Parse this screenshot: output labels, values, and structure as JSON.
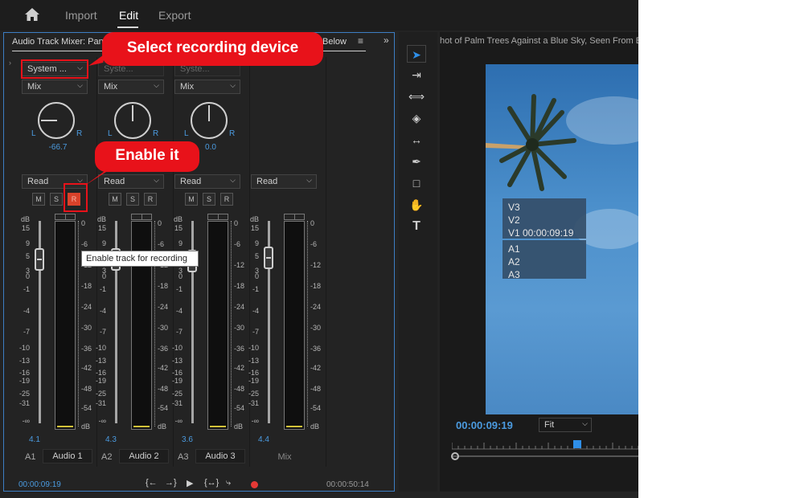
{
  "topbar": {
    "items": [
      "Import",
      "Edit",
      "Export"
    ],
    "active": "Edit"
  },
  "mixer": {
    "title": "Audio Track Mixer: Pan",
    "title_right": "Below",
    "menu_icon": "hamburger-icon",
    "left_scale": [
      "dB",
      "15",
      "9",
      "5",
      "3",
      "0",
      "-1",
      "-4",
      "-7",
      "-10",
      "-13",
      "-16",
      "-19",
      "-25",
      "-31",
      "-∞"
    ],
    "right_scale": [
      "0",
      "-6",
      "-12",
      "-18",
      "-24",
      "-30",
      "-36",
      "-42",
      "-48",
      "-54",
      "dB"
    ],
    "channels": [
      {
        "input": "System ...",
        "automation_top": "Mix",
        "pan": "-66.7",
        "automation": "Read",
        "level": "4.1",
        "id": "A1",
        "name": "Audio 1"
      },
      {
        "input": "Syste...",
        "automation_top": "Mix",
        "pan": "",
        "automation": "Read",
        "level": "4.3",
        "id": "A2",
        "name": "Audio 2"
      },
      {
        "input": "Syste...",
        "automation_top": "Mix",
        "pan": "0.0",
        "automation": "Read",
        "level": "3.6",
        "id": "A3",
        "name": "Audio 3"
      },
      {
        "input": "",
        "automation_top": "",
        "pan": "",
        "automation": "Read",
        "level": "4.4",
        "id": "",
        "name": "Mix"
      }
    ],
    "buttons": {
      "mute": "M",
      "solo": "S",
      "record": "R"
    },
    "knob_labels": {
      "left": "L",
      "right": "R"
    },
    "tooltip": "Enable track for recording",
    "timecode_current": "00:00:09:19",
    "timecode_end": "00:00:50:14",
    "transport": [
      "go-to-in-icon",
      "go-to-out-icon",
      "play-icon",
      "loop-icon",
      "export-icon",
      "record-icon"
    ]
  },
  "tools": [
    "selection-tool-icon",
    "track-select-icon",
    "ripple-edit-icon",
    "razor-icon",
    "slip-icon",
    "pen-icon",
    "rectangle-icon",
    "hand-icon",
    "type-icon"
  ],
  "monitor": {
    "title": "hot of Palm Trees Against a Blue Sky, Seen From B",
    "overlay_video": [
      "V3",
      "V2",
      "V1 00:00:09:19"
    ],
    "overlay_audio": [
      "A1",
      "A2",
      "A3"
    ],
    "timecode": "00:00:09:19",
    "fit": "Fit"
  },
  "callouts": {
    "select_device": "Select recording device",
    "enable": "Enable it"
  },
  "colors": {
    "accent": "#4b9be0",
    "record": "#d9422a",
    "callout": "#e8121a"
  }
}
